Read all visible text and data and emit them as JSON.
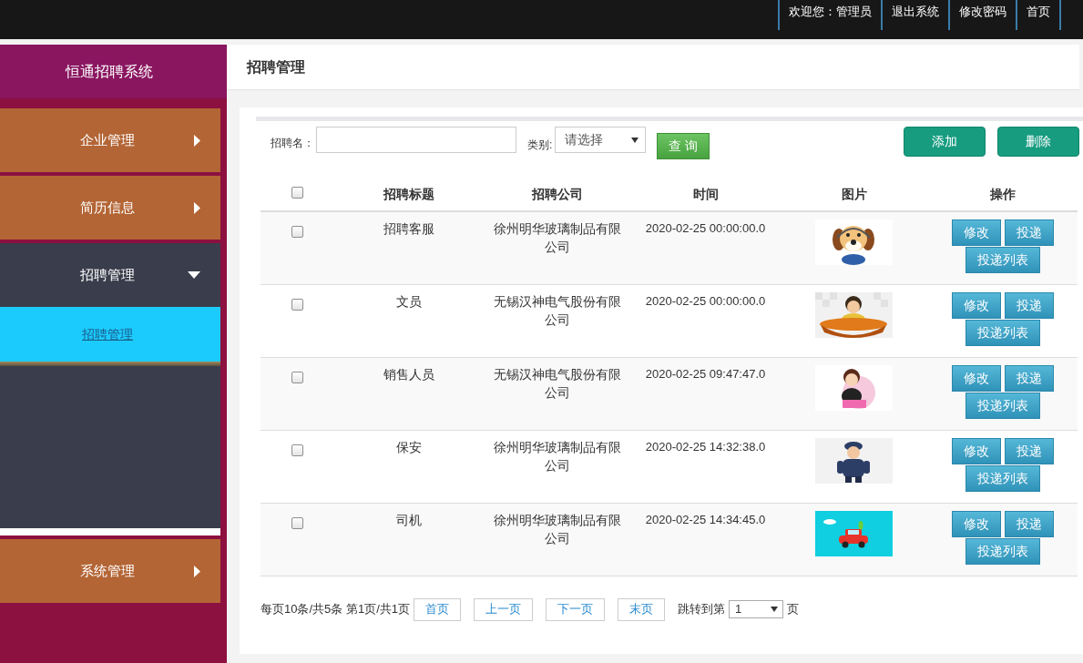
{
  "top_bar": {
    "welcome": "欢迎您：管理员",
    "nav_links": [
      "退出系统",
      "修改密码",
      "首页"
    ]
  },
  "sidebar": {
    "title": "恒通招聘系统",
    "menu": [
      {
        "label": "企业管理",
        "expanded": false
      },
      {
        "label": "简历信息",
        "expanded": false
      },
      {
        "label": "招聘管理",
        "expanded": true,
        "children": [
          {
            "label": "招聘管理",
            "selected": true
          }
        ]
      },
      {
        "label": "系统管理",
        "expanded": false
      }
    ]
  },
  "page_title": "招聘管理",
  "search": {
    "name_field": {
      "label": "招聘名："
    },
    "category_field": {
      "label": "类别:",
      "value": "请选择"
    },
    "query_button": "查 询"
  },
  "actions": [
    "添加",
    "删除"
  ],
  "table": {
    "header_checked": false,
    "columns": [
      "招聘标题",
      "招聘公司",
      "时间",
      "图片",
      "操作"
    ],
    "rows": [
      {
        "checked": false,
        "title": "招聘客服",
        "company": "徐州明华玻璃制品有限公司",
        "time": "2020-02-25 00:00:00.0",
        "picture": {
          "kind": "dog"
        },
        "actions": [
          "修改",
          "投递",
          "投递列表"
        ]
      },
      {
        "checked": false,
        "title": "文员",
        "company": "无锡汉神电气股份有限公司",
        "time": "2020-02-25 00:00:00.0",
        "picture": {
          "kind": "clerk"
        },
        "actions": [
          "修改",
          "投递",
          "投递列表"
        ]
      },
      {
        "checked": false,
        "title": "销售人员",
        "company": "无锡汉神电气股份有限公司",
        "time": "2020-02-25 09:47:47.0",
        "picture": {
          "kind": "saleswoman"
        },
        "actions": [
          "修改",
          "投递",
          "投递列表"
        ]
      },
      {
        "checked": false,
        "title": "保安",
        "company": "徐州明华玻璃制品有限公司",
        "time": "2020-02-25 14:32:38.0",
        "picture": {
          "kind": "guard"
        },
        "actions": [
          "修改",
          "投递",
          "投递列表"
        ]
      },
      {
        "checked": false,
        "title": "司机",
        "company": "徐州明华玻璃制品有限公司",
        "time": "2020-02-25 14:34:45.0",
        "picture": {
          "kind": "car"
        },
        "actions": [
          "修改",
          "投递",
          "投递列表"
        ]
      }
    ]
  },
  "pagination": {
    "summary": "每页10条/共5条 第1页/共1页",
    "buttons": [
      "首页",
      "上一页",
      "下一页",
      "末页"
    ],
    "jump_label": "跳转到第",
    "page_value": "1",
    "page_suffix": "页"
  }
}
